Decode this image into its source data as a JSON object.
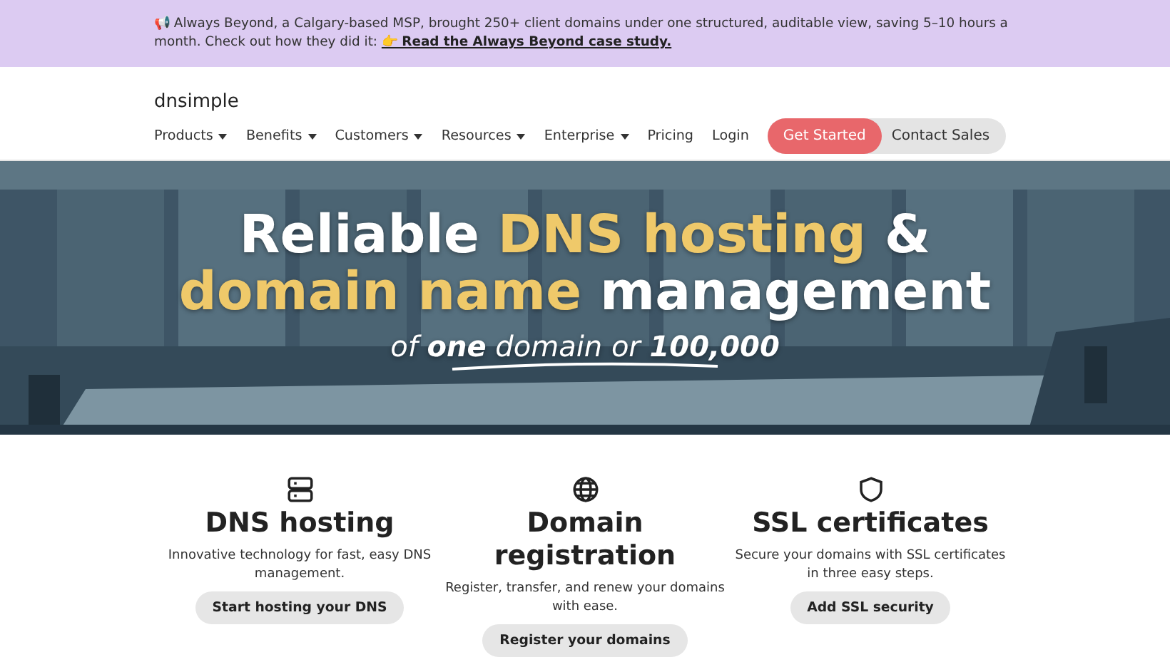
{
  "announcement": {
    "text": "📢 Always Beyond, a Calgary-based MSP, brought 250+ client domains under one structured, auditable view, saving 5–10 hours a month. Check out how they did it:",
    "link": "👉 Read the Always Beyond case study."
  },
  "header": {
    "logo": "dnsimple",
    "nav": [
      {
        "label": "Products",
        "dropdown": true
      },
      {
        "label": "Benefits",
        "dropdown": true
      },
      {
        "label": "Customers",
        "dropdown": true
      },
      {
        "label": "Resources",
        "dropdown": true
      },
      {
        "label": "Enterprise",
        "dropdown": true
      },
      {
        "label": "Pricing",
        "dropdown": false
      },
      {
        "label": "Login",
        "dropdown": false
      }
    ],
    "primary_button": "Get Started",
    "secondary_button": "Contact Sales"
  },
  "hero": {
    "kind": "picture",
    "title_lines": [
      "Reliable **DNS hosting** &",
      "**domain name** management"
    ],
    "subtitle": "of **one** domain or **100,000**"
  },
  "features": [
    {
      "title": "DNS hosting",
      "description": "Innovative technology for fast, easy DNS management.",
      "button": "Start hosting your DNS"
    },
    {
      "title": "Domain registration",
      "description": "Register, transfer, and renew your domains with ease.",
      "button": "Register your domains"
    },
    {
      "title": "SSL certificates",
      "description": "Secure your domains with SSL certificates in three easy steps.",
      "button": "Add SSL security"
    }
  ]
}
